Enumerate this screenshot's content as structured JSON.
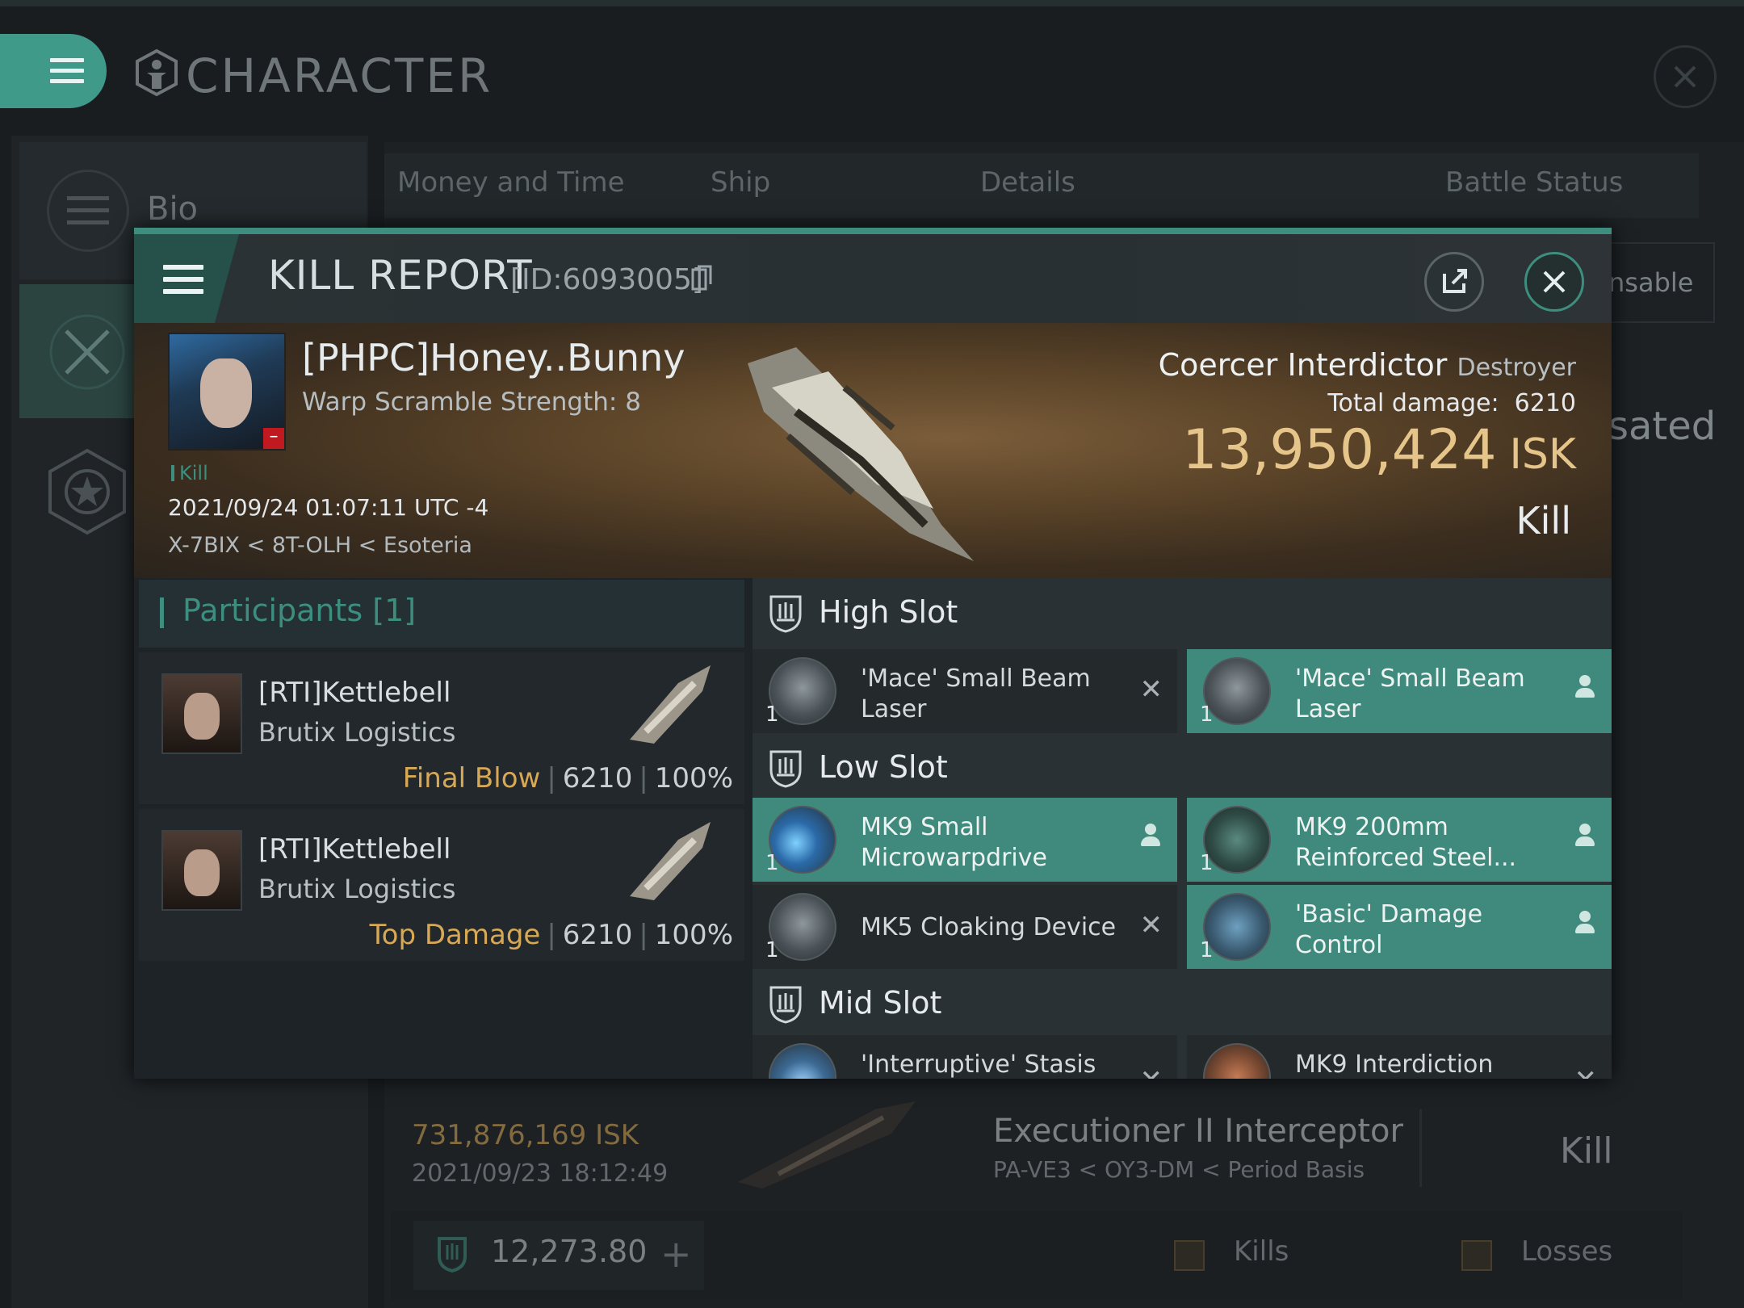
{
  "app": {
    "title": "CHARACTER",
    "sidebar": {
      "bio_label": "Bio"
    },
    "tabs": [
      "Money and Time",
      "Ship",
      "Details",
      "Battle Status"
    ],
    "right_ghost_text": "nsable",
    "right_ghost_text2": "sated",
    "background_row": {
      "isk": "731,876,169  ISK",
      "date": "2021/09/23  18:12:49",
      "ship": "Executioner II Interceptor",
      "location": "PA-VE3 < OY3-DM < Period Basis",
      "result": "Kill"
    },
    "bottom_bar": {
      "value": "12,273.80",
      "kills_label": "Kills",
      "losses_label": "Losses"
    }
  },
  "kill_report": {
    "title": "KILL REPORT",
    "id_text": "[ID:6093005]",
    "victim": {
      "name": "[PHPC]Honey..Bunny",
      "warp_scramble": "Warp Scramble Strength: 8",
      "tag": "Kill",
      "datetime": "2021/09/24 01:07:11 UTC -4",
      "location": "X-7BIX < 8T-OLH < Esoteria"
    },
    "ship": {
      "name": "Coercer Interdictor",
      "class": "Destroyer",
      "total_damage_label": "Total damage:",
      "total_damage": "6210",
      "isk_value": "13,950,424",
      "isk_unit": "ISK",
      "result": "Kill"
    },
    "participants": {
      "header": "Participants [1]",
      "rows": [
        {
          "name": "[RTI]Kettlebell",
          "corp": "Brutix Logistics",
          "label": "Final Blow",
          "damage": "6210",
          "percent": "100%"
        },
        {
          "name": "[RTI]Kettlebell",
          "corp": "Brutix Logistics",
          "label": "Top Damage",
          "damage": "6210",
          "percent": "100%"
        }
      ]
    },
    "slots": {
      "high_label": "High Slot",
      "low_label": "Low Slot",
      "mid_label": "Mid Slot",
      "high": [
        {
          "qty": "1",
          "name": "'Mace' Small Beam Laser",
          "state": "destroyed"
        },
        {
          "qty": "1",
          "name": "'Mace' Small Beam Laser",
          "state": "dropped"
        }
      ],
      "low": [
        {
          "qty": "1",
          "name": "MK9 Small Microwarpdrive",
          "state": "dropped"
        },
        {
          "qty": "1",
          "name": "MK9 200mm Reinforced Steel...",
          "state": "dropped"
        },
        {
          "qty": "1",
          "name": "MK5 Cloaking Device",
          "state": "destroyed"
        },
        {
          "qty": "1",
          "name": "'Basic'  Damage Control",
          "state": "dropped"
        }
      ],
      "mid": [
        {
          "qty": "1",
          "name": "'Interruptive' Stasis",
          "state": "destroyed"
        },
        {
          "qty": "1",
          "name": "MK9 Interdiction",
          "state": "destroyed"
        }
      ]
    },
    "colors": {
      "accent": "#3e8e80",
      "isk": "#e5c58a",
      "final_blow": "#d7a856"
    }
  }
}
